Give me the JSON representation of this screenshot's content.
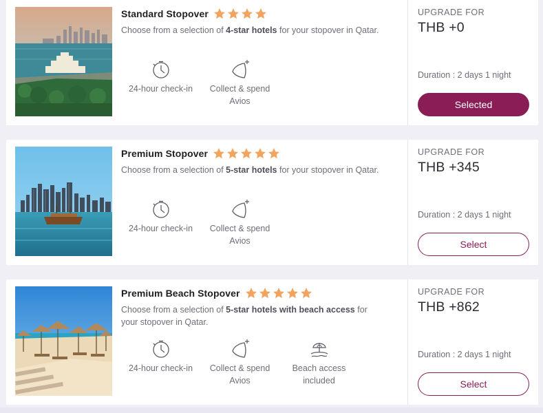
{
  "colors": {
    "accent": "#8a1c56",
    "star": "#f2a35e"
  },
  "cards": [
    {
      "title": "Standard Stopover",
      "stars": 4,
      "desc_pre": "Choose from a selection of ",
      "desc_bold": "4-star hotels",
      "desc_post": " for your stopover in Qatar.",
      "features": [
        {
          "icon": "clock-icon",
          "label": "24-hour check-in"
        },
        {
          "icon": "avios-icon",
          "label": "Collect & spend Avios"
        }
      ],
      "upgrade_label": "UPGRADE FOR",
      "price": "THB +0",
      "duration": "Duration : 2 days 1 night",
      "button_label": "Selected",
      "selected": true,
      "photo": "doha-museum-skyline-photo"
    },
    {
      "title": "Premium Stopover",
      "stars": 5,
      "desc_pre": "Choose from a selection of ",
      "desc_bold": "5-star hotels",
      "desc_post": " for your stopover in Qatar.",
      "features": [
        {
          "icon": "clock-icon",
          "label": "24-hour check-in"
        },
        {
          "icon": "avios-icon",
          "label": "Collect & spend Avios"
        }
      ],
      "upgrade_label": "UPGRADE FOR",
      "price": "THB +345",
      "duration": "Duration : 2 days 1 night",
      "button_label": "Select",
      "selected": false,
      "photo": "doha-dhow-skyline-photo"
    },
    {
      "title": "Premium Beach Stopover",
      "stars": 5,
      "desc_pre": "Choose from a selection of ",
      "desc_bold": "5-star hotels with beach access",
      "desc_post": " for your stopover in Qatar.",
      "features": [
        {
          "icon": "clock-icon",
          "label": "24-hour check-in"
        },
        {
          "icon": "avios-icon",
          "label": "Collect & spend Avios"
        },
        {
          "icon": "beach-umbrella-icon",
          "label": "Beach access included"
        }
      ],
      "upgrade_label": "UPGRADE FOR",
      "price": "THB +862",
      "duration": "Duration : 2 days 1 night",
      "button_label": "Select",
      "selected": false,
      "photo": "beach-umbrellas-photo"
    }
  ]
}
